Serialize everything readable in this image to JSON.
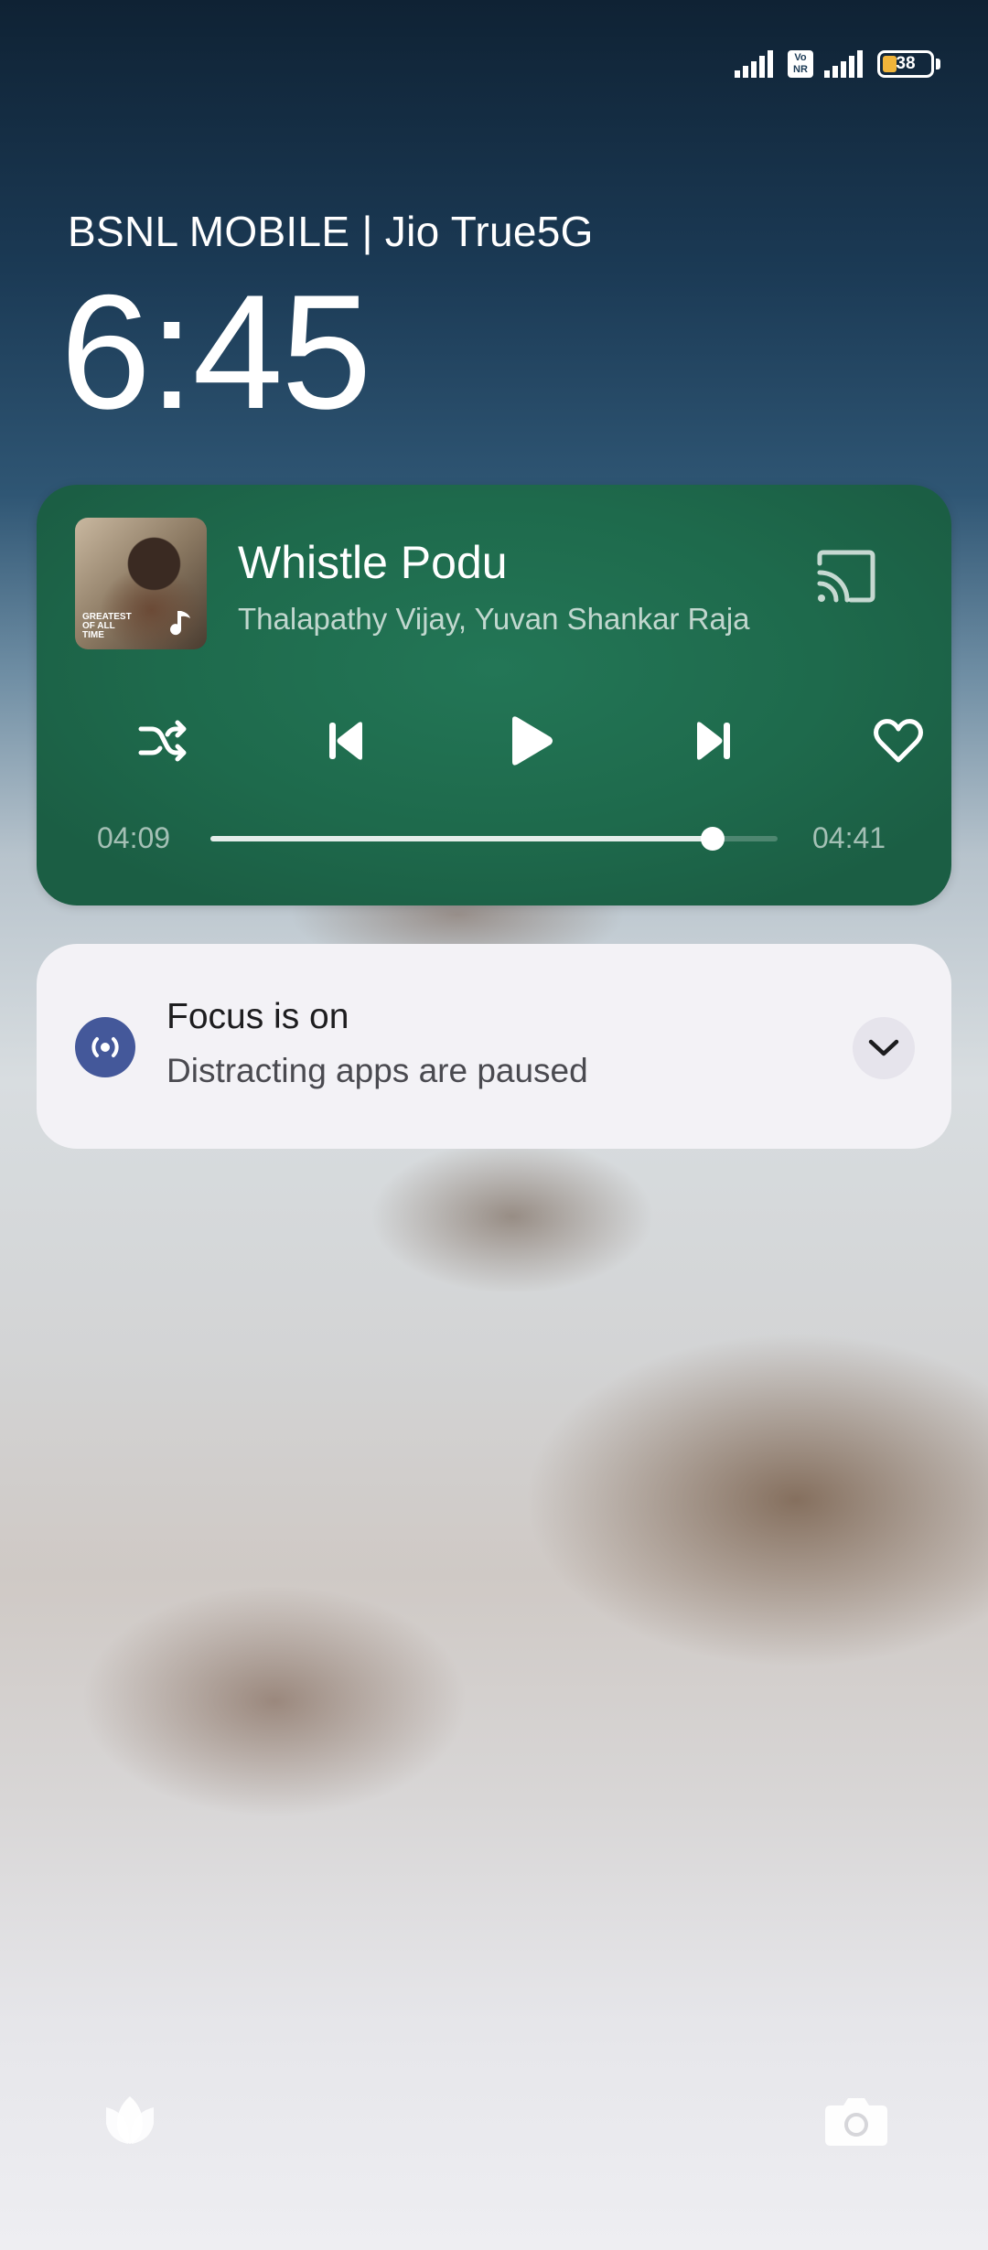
{
  "status_bar": {
    "battery_level": "38",
    "battery_percent": 38,
    "vonr_label": "Vo NR",
    "signal_icons": [
      "signal-1-icon",
      "signal-2-icon"
    ],
    "battery_color": "#f0b43a"
  },
  "lock_screen": {
    "carrier": "BSNL MOBILE | Jio True5G",
    "time": "6:45"
  },
  "media_player": {
    "title": "Whistle Podu",
    "artist": "Thalapathy Vijay, Yuvan Shankar Raja",
    "album_art_text": "GREATEST OF ALL TIME",
    "elapsed": "04:09",
    "duration": "04:41",
    "progress_fraction": 0.886,
    "icons": {
      "cast": "cast-icon",
      "shuffle": "shuffle-icon",
      "previous": "skip-previous-icon",
      "play": "play-icon",
      "next": "skip-next-icon",
      "like": "heart-icon"
    },
    "background_color": "#1f6b4d"
  },
  "focus_notification": {
    "title": "Focus is on",
    "subtitle": "Distracting apps are paused",
    "icon": "focus-mode-icon",
    "expand_icon": "chevron-down-icon",
    "icon_color": "#44589a"
  },
  "shortcuts": {
    "left_icon": "lotus-icon",
    "right_icon": "camera-icon"
  }
}
